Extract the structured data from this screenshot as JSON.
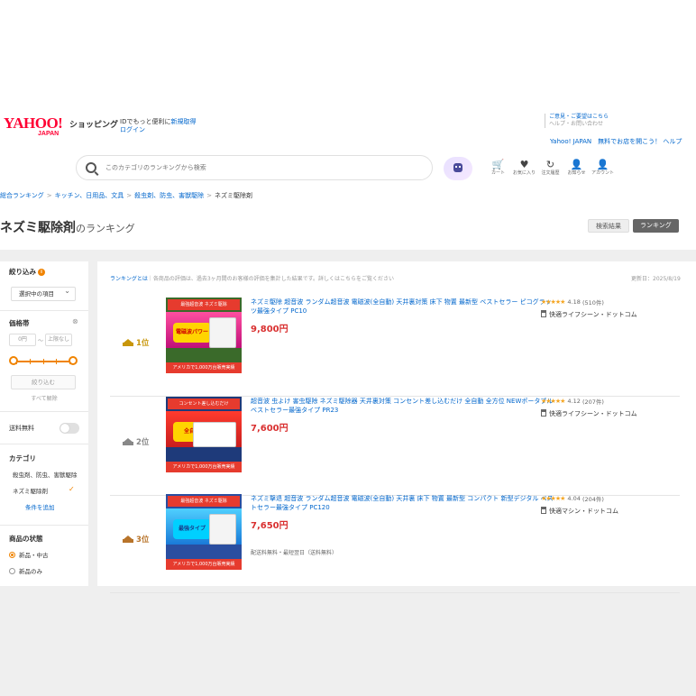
{
  "header": {
    "logo_main": "YAHOO!",
    "logo_sub": "JAPAN",
    "shop_label": "ショッピング",
    "login_prompt_prefix": "IDでもっと便利に",
    "register_label": "新規取得",
    "login_label": "ログイン",
    "right_links_1": "ご意見・ご要望はこちら",
    "right_links_2": "ヘルプ・お問い合わせ",
    "right_bottom": "Yahoo! JAPAN　無料でお店を開こう！ ヘルプ"
  },
  "search": {
    "placeholder": "このカテゴリのランキングから検索"
  },
  "nav_icons": [
    {
      "icon": "cart-icon",
      "glyph": "🛒",
      "label": "カート"
    },
    {
      "icon": "heart-icon",
      "glyph": "♥",
      "label": "お気に入り"
    },
    {
      "icon": "history-icon",
      "glyph": "↻",
      "label": "注文履歴"
    },
    {
      "icon": "person-icon",
      "glyph": "👤",
      "label": "お知らせ"
    },
    {
      "icon": "account-icon",
      "glyph": "👤",
      "label": "アカウント"
    }
  ],
  "breadcrumb": [
    "総合ランキング",
    "キッチン、日用品、文具",
    "殺虫剤、防虫、害獣駆除",
    "ネズミ駆除剤"
  ],
  "page": {
    "title": "ネズミ駆除剤",
    "title_suffix": "のランキング",
    "tab_inactive": "検索結果",
    "tab_active": "ランキング"
  },
  "sidebar": {
    "filter_title": "絞り込み",
    "select_label": "選択中の項目",
    "price_title": "価格帯",
    "price_min": "0円",
    "price_max": "上限なし",
    "apply_label": "絞り込む",
    "reset_label": "すべて解除",
    "free_shipping_label": "送料無料",
    "category_title": "カテゴリ",
    "category_parent": "殺虫剤、防虫、害獣駆除",
    "category_selected": "ネズミ駆除剤",
    "more_label": "条件を追加",
    "condition_title": "商品の状態",
    "condition_opt1": "新品・中古",
    "condition_opt2": "新品のみ"
  },
  "main": {
    "note_link": "ランキングとは",
    "note_text": "｜各商品の評価は、過去3ヶ月間のお客様の評価を集計した結果です。詳しくはこちらをご覧ください",
    "updated": "更新日：2025/8/19"
  },
  "items": [
    {
      "rank": "1位",
      "name": "ネズミ駆除 超音波 ランダム超音波 電磁波(全自動) 天井裏対策 床下 物置 最新型 ベストセラー ピコグラッツ最強タイプ PC10",
      "price": "9,800円",
      "rating": "4.18",
      "reviews": "(510件)",
      "store": "快適ライフシーン・ドットコム",
      "thumb_head": "最強超音波 ネズミ駆除",
      "thumb_badge": "電磁波パワー",
      "thumb_foot": "アメリカで1,000万台販売実績"
    },
    {
      "rank": "2位",
      "name": "超音波 虫よけ 害虫駆除 ネズミ駆除器 天井裏対策 コンセント差し込むだけ 全自動 全方位 NEWポータブル ベストセラー最強タイプ PR23",
      "price": "7,600円",
      "rating": "4.12",
      "reviews": "(207件)",
      "store": "快適ライフシーン・ドットコム",
      "thumb_head": "コンセント差し込むだけ",
      "thumb_badge": "全自動",
      "thumb_foot": "アメリカで1,000万台販売実績"
    },
    {
      "rank": "3位",
      "name": "ネズミ撃退 超音波 ランダム超音波 電磁波(全自動) 天井裏 床下 物置 最新型 コンパクト 新型デジタル ベストセラー最強タイプ PC120",
      "price": "7,650円",
      "rating": "4.04",
      "reviews": "(204件)",
      "store": "快適マシン・ドットコム",
      "shipping_note": "配送料無料・最短翌日（送料無料）",
      "thumb_head": "最強超音波 ネズミ駆除",
      "thumb_badge": "最強タイプ",
      "thumb_foot": "アメリカで1,000万台販売実績"
    }
  ]
}
